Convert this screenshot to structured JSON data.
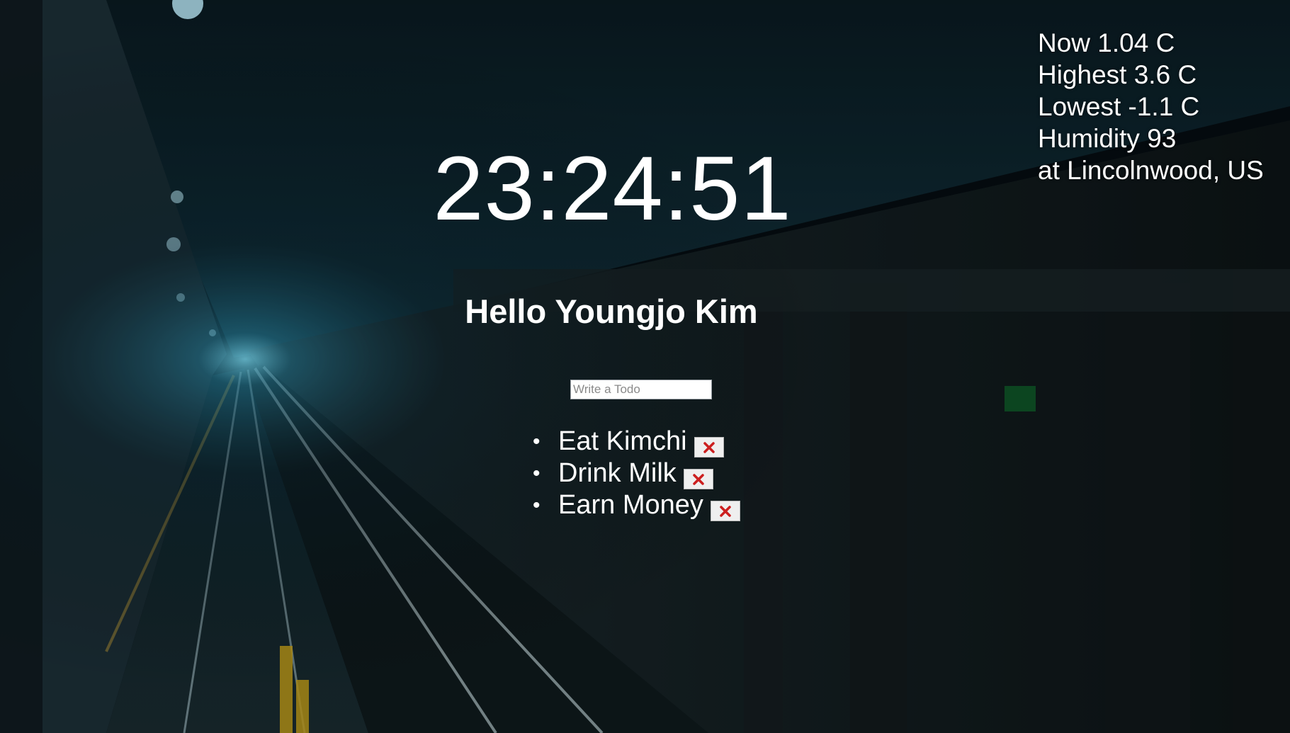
{
  "weather": {
    "now": "Now 1.04 C",
    "highest": "Highest 3.6 C",
    "lowest": "Lowest -1.1 C",
    "humidity": "Humidity 93",
    "location": "at Lincolnwood, US"
  },
  "clock": {
    "time": "23:24:51"
  },
  "greeting": {
    "text": "Hello Youngjo Kim"
  },
  "todo_form": {
    "placeholder": "Write a Todo",
    "value": ""
  },
  "todos": [
    {
      "text": "Eat Kimchi",
      "delete_icon": "red-x-icon"
    },
    {
      "text": "Drink Milk",
      "delete_icon": "red-x-icon"
    },
    {
      "text": "Earn Money",
      "delete_icon": "red-x-icon"
    }
  ],
  "colors": {
    "text": "#ffffff",
    "delete_x": "#cc1f1f",
    "background": "#050d12"
  }
}
